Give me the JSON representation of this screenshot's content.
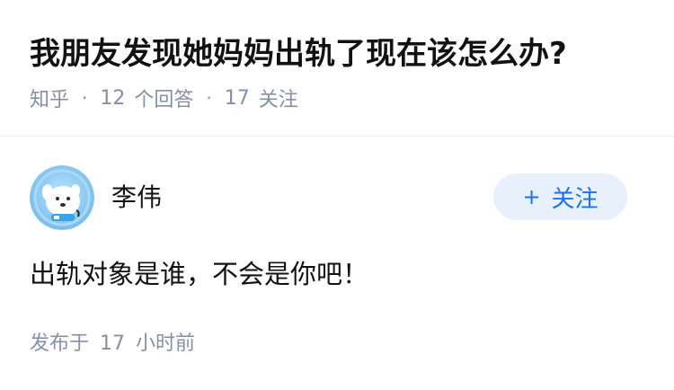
{
  "question": {
    "title": "我朋友发现她妈妈出轨了现在该怎么办?",
    "source": "知乎",
    "separator": "·",
    "answer_count": "12",
    "answer_label": "个回答",
    "follower_count": "17",
    "follower_label": "关注"
  },
  "answer": {
    "author_name": "李伟",
    "follow_plus": "+",
    "follow_label": "关注",
    "content": "出轨对象是谁，不会是你吧！",
    "publish_prefix": "发布于",
    "publish_num": "17",
    "publish_unit": "小时前"
  },
  "colors": {
    "accent": "#1772f6",
    "follow_bg": "#e8f1fb",
    "meta_gray": "#8590a6",
    "text": "#121212"
  },
  "icons": {
    "avatar": "cartoon-dog-astronaut-avatar"
  }
}
